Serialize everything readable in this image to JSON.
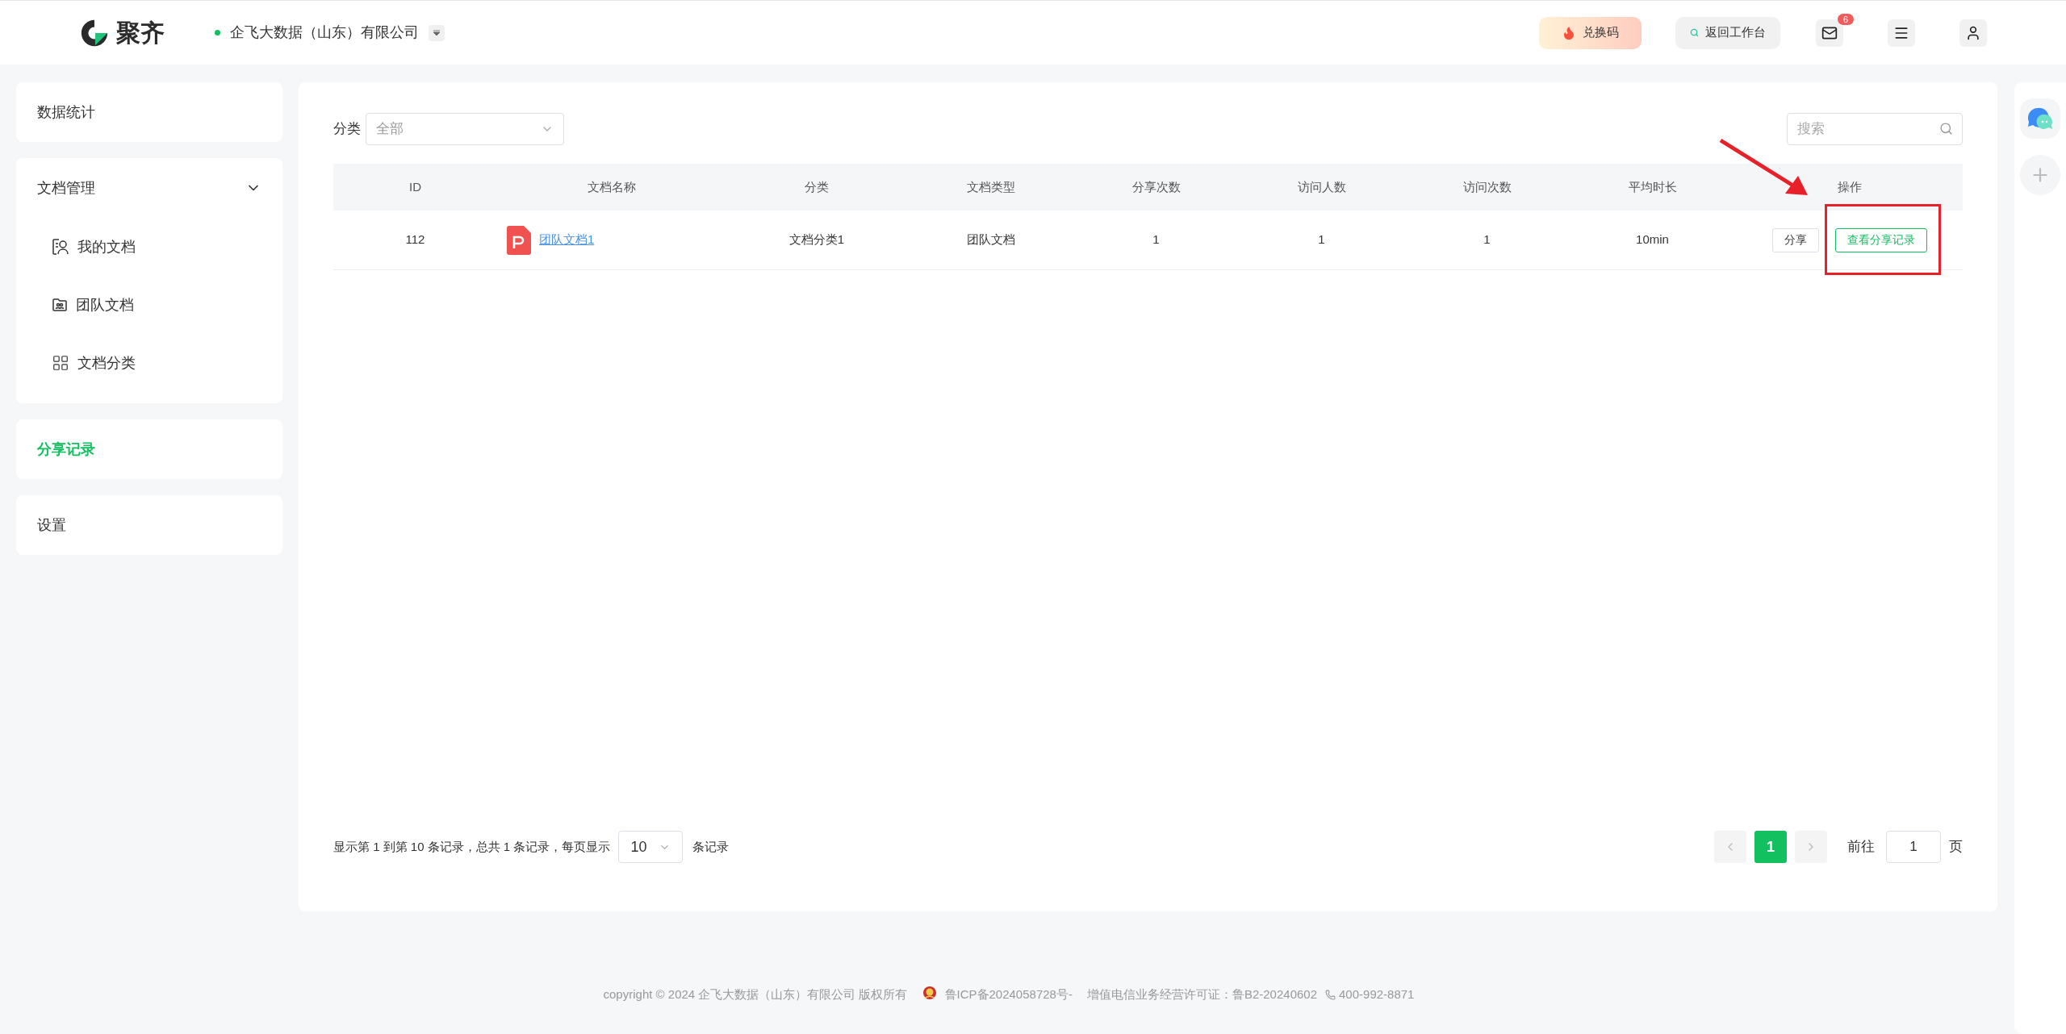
{
  "header": {
    "brand": "聚齐",
    "company": "企飞大数据（山东）有限公司",
    "redeem_button": "兑换码",
    "workbench_button": "返回工作台",
    "mail_badge": "6"
  },
  "sidebar": {
    "groups": [
      {
        "label": "数据统计",
        "selected": false
      },
      {
        "label": "文档管理",
        "expanded": true,
        "selected": false,
        "children": [
          {
            "label": "我的文档",
            "kind": "person"
          },
          {
            "label": "团队文档",
            "kind": "team"
          },
          {
            "label": "文档分类",
            "kind": "grid"
          }
        ]
      },
      {
        "label": "分享记录",
        "selected": true
      },
      {
        "label": "设置",
        "selected": false
      }
    ]
  },
  "filter": {
    "label": "分类",
    "value": "全部"
  },
  "search": {
    "placeholder": "搜索"
  },
  "table": {
    "columns": [
      "ID",
      "文档名称",
      "分类",
      "文档类型",
      "分享次数",
      "访问人数",
      "访问次数",
      "平均时长",
      "操作"
    ],
    "rows": [
      {
        "id": "112",
        "name": "团队文档1",
        "category": "文档分类1",
        "type": "团队文档",
        "shares": "1",
        "visitors": "1",
        "visits": "1",
        "avg_duration": "10min",
        "actions": [
          "分享",
          "查看分享记录"
        ]
      }
    ]
  },
  "pagination": {
    "summary": "显示第 1 到第 10 条记录，总共 1 条记录，每页显示",
    "page_size": "10",
    "page_size_suffix": "条记录",
    "pages": [
      {
        "label": "1",
        "selected": true
      }
    ],
    "goto_label": "前往",
    "goto_value": "1",
    "goto_suffix": "页"
  },
  "footer": {
    "copyright": "copyright © 2024 企飞大数据（山东）有限公司 版权所有",
    "icp": "鲁ICP备2024058728号-",
    "license": "增值电信业务经营许可证：鲁B2-20240602",
    "phone": "400-992-8871"
  }
}
